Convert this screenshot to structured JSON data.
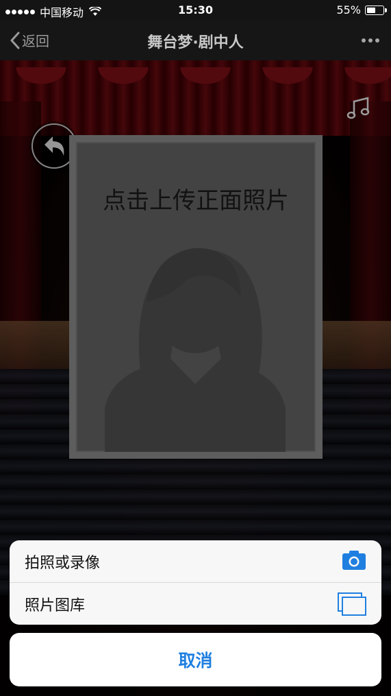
{
  "status_bar": {
    "carrier": "中国移动",
    "time": "15:30",
    "battery_percent": "55%",
    "battery_level": 0.55
  },
  "nav": {
    "back_label": "返回",
    "title": "舞台梦·剧中人",
    "more_icon": "more-dots-icon"
  },
  "content": {
    "upload_prompt": "点击上传正面照片",
    "music_icon": "music-note-icon",
    "back_icon": "return-arrow-icon"
  },
  "action_sheet": {
    "options": [
      {
        "label": "拍照或录像",
        "icon": "camera-icon"
      },
      {
        "label": "照片图库",
        "icon": "photo-library-icon"
      }
    ],
    "cancel_label": "取消"
  },
  "colors": {
    "accent": "#1f7fe0",
    "photo_frame": "#828282",
    "photo_background": "#5e5e5e"
  }
}
